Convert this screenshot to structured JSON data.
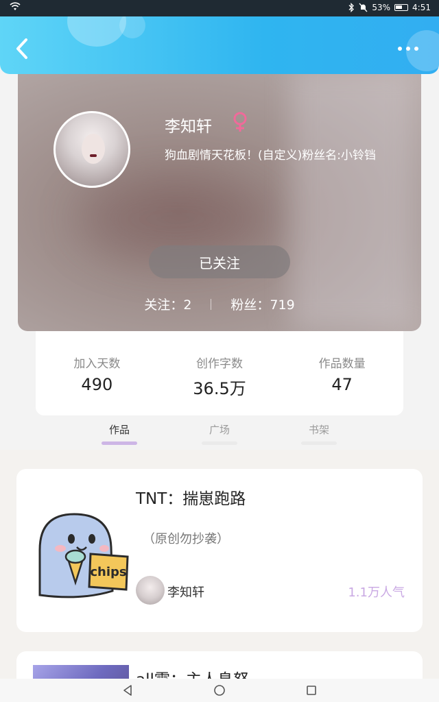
{
  "status_bar": {
    "battery": "53%",
    "time": "4:51"
  },
  "profile": {
    "name": "李知轩",
    "bio": "狗血剧情天花板！(自定义)粉丝名:小铃铛",
    "follow_button": "已关注",
    "following_label": "关注：",
    "following_count": "2",
    "fans_label": "粉丝：",
    "fans_count": "719"
  },
  "stats": [
    {
      "label": "加入天数",
      "value": "490"
    },
    {
      "label": "创作字数",
      "value": "36.5万"
    },
    {
      "label": "作品数量",
      "value": "47"
    }
  ],
  "tabs": [
    {
      "label": "作品",
      "active": true
    },
    {
      "label": "广场",
      "active": false
    },
    {
      "label": "书架",
      "active": false
    }
  ],
  "works": [
    {
      "title": "TNT：揣崽跑路",
      "subtitle": "（原创勿抄袭）",
      "author": "李知轩",
      "popularity": "1.1万人气",
      "cover_text": "chips"
    },
    {
      "title": "all霆：主人息怒"
    }
  ],
  "icons": {
    "back": "back-arrow-icon",
    "more": "more-dots-icon",
    "gender": "female-icon",
    "nav_back": "triangle-back-icon",
    "nav_home": "circle-home-icon",
    "nav_recent": "square-recent-icon"
  },
  "colors": {
    "header_gradient_start": "#5fd5f7",
    "header_gradient_end": "#32aef1",
    "gender_pink": "#f06a9a",
    "popularity_purple": "#c9a8e3",
    "active_tab_bar": "#cdb6e6"
  }
}
